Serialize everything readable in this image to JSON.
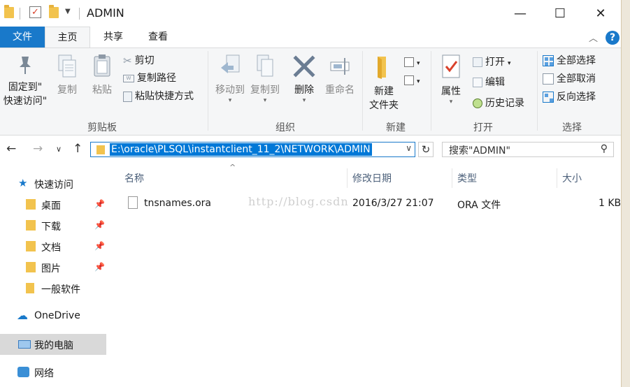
{
  "window": {
    "title": "ADMIN",
    "minimize": "—",
    "maximize": "☐",
    "close": "✕"
  },
  "tabs": [
    {
      "label": "文件"
    },
    {
      "label": "主页"
    },
    {
      "label": "共享"
    },
    {
      "label": "查看"
    }
  ],
  "ribbon": {
    "clipboard": {
      "label": "剪贴板",
      "pin_quick_access": "固定到\"\n快速访问\"",
      "pin_line1": "固定到\"",
      "pin_line2": "快速访问\"",
      "copy": "复制",
      "paste": "粘贴",
      "cut": "剪切",
      "copy_path": "复制路径",
      "paste_shortcut": "粘贴快捷方式"
    },
    "organize": {
      "label": "组织",
      "move_to": "移动到",
      "copy_to": "复制到",
      "delete": "删除",
      "rename": "重命名"
    },
    "new": {
      "label": "新建",
      "new_folder_line1": "新建",
      "new_folder_line2": "文件夹"
    },
    "open": {
      "label": "打开",
      "properties": "属性",
      "open": "打开",
      "edit": "编辑",
      "history": "历史记录"
    },
    "select": {
      "label": "选择",
      "select_all": "全部选择",
      "select_none": "全部取消",
      "invert": "反向选择"
    }
  },
  "address": {
    "path": "E:\\oracle\\PLSQL\\instantclient_11_2\\NETWORK\\ADMIN",
    "search_placeholder": "搜索\"ADMIN\""
  },
  "navpane": {
    "quick_access": "快速访问",
    "items": [
      {
        "label": "桌面"
      },
      {
        "label": "下载"
      },
      {
        "label": "文档"
      },
      {
        "label": "图片"
      },
      {
        "label": "一般软件"
      }
    ],
    "onedrive": "OneDrive",
    "this_pc": "我的电脑",
    "network": "网络"
  },
  "columns": {
    "name": "名称",
    "date": "修改日期",
    "type": "类型",
    "size": "大小"
  },
  "files": [
    {
      "name": "tnsnames.ora",
      "date": "2016/3/27 21:07",
      "type": "ORA 文件",
      "size": "1 KB"
    }
  ],
  "watermark": "http://blog.csdn"
}
